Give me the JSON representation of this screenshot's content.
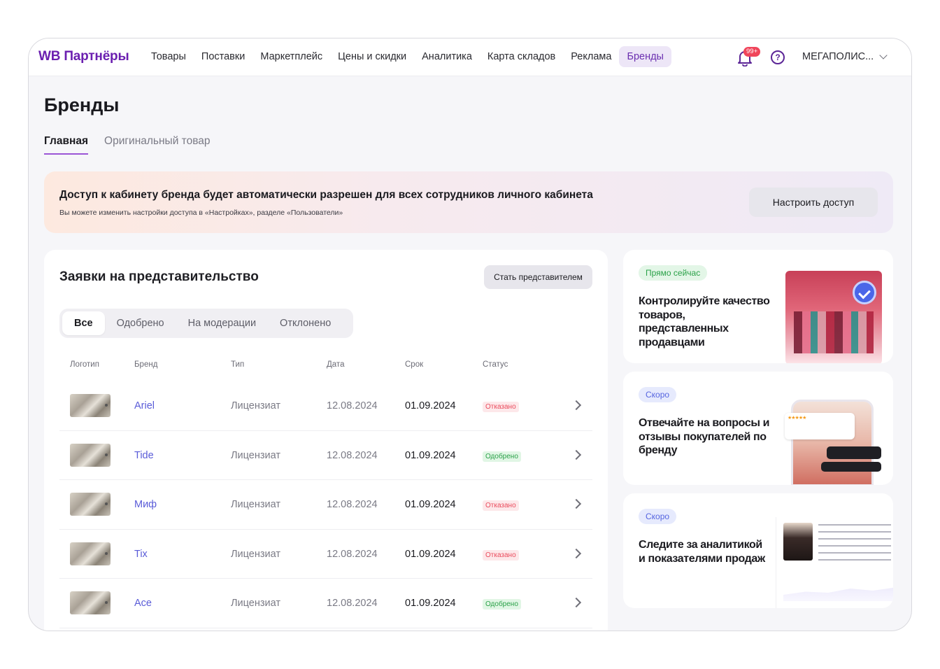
{
  "header": {
    "logo": "WB Партнёры",
    "nav": [
      "Товары",
      "Поставки",
      "Маркетплейс",
      "Цены и скидки",
      "Аналитика",
      "Карта складов",
      "Реклама",
      "Бренды"
    ],
    "active_nav": "Бренды",
    "notifications_badge": "99+",
    "help_icon": "?",
    "account": "МЕГАПОЛИС..."
  },
  "page": {
    "title": "Бренды",
    "tabs": [
      "Главная",
      "Оригинальный товар"
    ]
  },
  "banner": {
    "title": "Доступ к кабинету бренда будет автоматически разрешен для всех сотрудников личного кабинета",
    "subtitle": "Вы можете изменить настройки доступа в «Настройках», разделе «Пользователи»",
    "button": "Настроить доступ"
  },
  "requests": {
    "title": "Заявки на представительство",
    "become_button": "Стать представителем",
    "filters": [
      "Все",
      "Одобрено",
      "На модерации",
      "Отклонено"
    ],
    "columns": [
      "Логотип",
      "Бренд",
      "Тип",
      "Дата",
      "Срок",
      "Статус"
    ],
    "rows": [
      {
        "brand": "Ariel",
        "type": "Лицензиат",
        "date": "12.08.2024",
        "term": "01.09.2024",
        "status": "Отказано"
      },
      {
        "brand": "Tide",
        "type": "Лицензиат",
        "date": "12.08.2024",
        "term": "01.09.2024",
        "status": "Одобрено"
      },
      {
        "brand": "Миф",
        "type": "Лицензиат",
        "date": "12.08.2024",
        "term": "01.09.2024",
        "status": "Отказано"
      },
      {
        "brand": "Tix",
        "type": "Лицензиат",
        "date": "12.08.2024",
        "term": "01.09.2024",
        "status": "Отказано"
      },
      {
        "brand": "Ace",
        "type": "Лицензиат",
        "date": "12.08.2024",
        "term": "01.09.2024",
        "status": "Одобрено"
      }
    ]
  },
  "promo_cards": [
    {
      "tag": "Прямо сейчас",
      "text": "Контролируйте качество товаров, представленных продавцами"
    },
    {
      "tag": "Скоро",
      "text": "Отвечайте на вопросы и отзывы покупателей по бренду"
    },
    {
      "tag": "Скоро",
      "text": "Следите за аналитикой и показателями продаж"
    }
  ],
  "colors": {
    "brand": "#6b1fb0",
    "link": "#5a5cd8",
    "status_rejected": "#ea4b5c",
    "status_approved": "#2aa148"
  }
}
